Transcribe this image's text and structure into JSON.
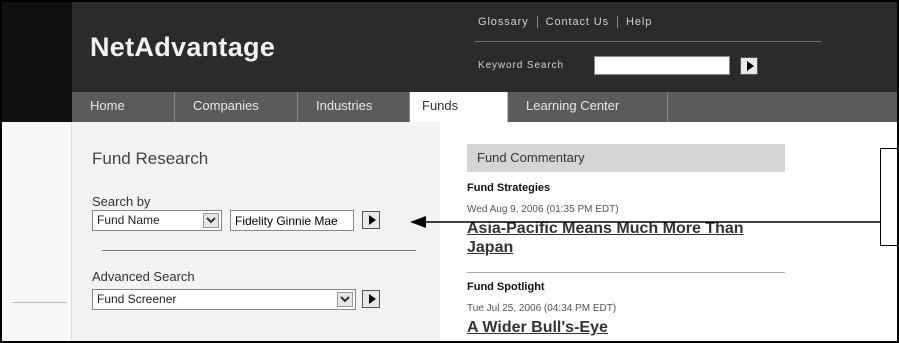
{
  "header": {
    "logo": "NetAdvantage",
    "utility_links": [
      "Glossary",
      "Contact Us",
      "Help"
    ],
    "keyword_label": "Keyword Search",
    "keyword_value": "",
    "go_icon": "play-arrow-icon"
  },
  "nav": {
    "tabs": [
      "Home",
      "Companies",
      "Industries",
      "Funds",
      "Learning Center"
    ],
    "active": "Funds"
  },
  "fund_research": {
    "title": "Fund Research",
    "search_by_label": "Search by",
    "search_by_selected": "Fund Name",
    "search_query": "Fidelity Ginnie Mae",
    "advanced_label": "Advanced Search",
    "advanced_selected": "Fund Screener"
  },
  "commentary": {
    "header": "Fund Commentary",
    "articles": [
      {
        "kicker": "Fund Strategies",
        "date": "Wed Aug 9, 2006 (01:35 PM EDT)",
        "headline": "Asia-Pacific Means Much More Than Japan"
      },
      {
        "kicker": "Fund Spotlight",
        "date": "Tue Jul 25, 2006 (04:34 PM EDT)",
        "headline": "A Wider Bull's-Eye"
      }
    ]
  },
  "colors": {
    "header_bg": "#2b2b2b",
    "nav_bg": "#5b5b5b",
    "panel_bg": "#f3f3f3",
    "commentary_header_bg": "#d5d5d5"
  }
}
